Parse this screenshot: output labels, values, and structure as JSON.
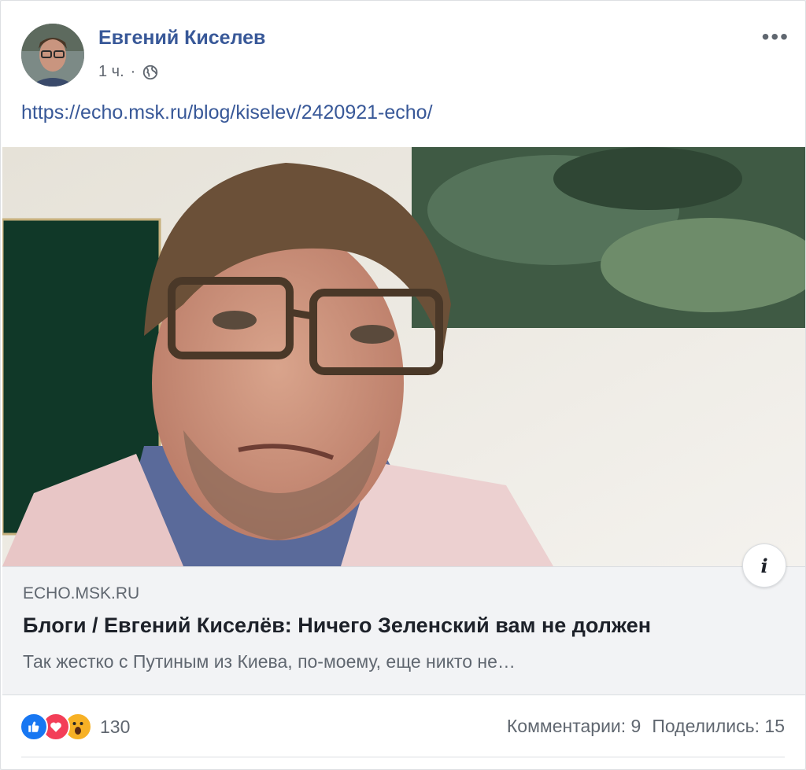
{
  "post": {
    "author": "Евгений Киселев",
    "time": "1 ч.",
    "separator": "·",
    "privacy_icon": "globe-icon",
    "menu_icon": "more-options-icon",
    "menu_label": "•••",
    "text_link": "https://echo.msk.ru/blog/kiselev/2420921-echo/"
  },
  "preview": {
    "domain": "ECHO.MSK.RU",
    "title": "Блоги / Евгений Киселёв: Ничего Зеленский вам не должен",
    "description": "Так жестко с Путиным из Киева, по-моему, еще никто не…",
    "info_label": "i"
  },
  "footer": {
    "reactions": [
      "like",
      "love",
      "wow"
    ],
    "reaction_count": "130",
    "comments": "Комментарии: 9",
    "shares": "Поделились: 15"
  },
  "colors": {
    "link": "#385898",
    "like": "#1877f2",
    "love": "#f33e58",
    "wow": "#f7b125"
  }
}
